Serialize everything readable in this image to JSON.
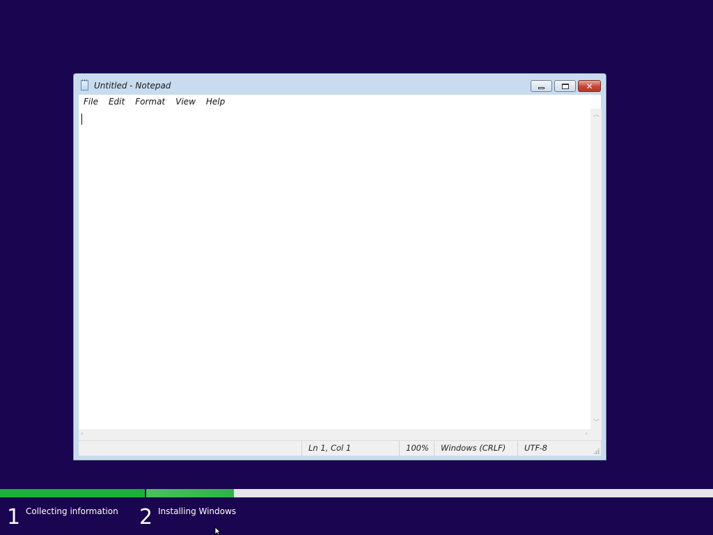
{
  "window": {
    "title": "Untitled - Notepad",
    "controls": {
      "minimize": "minimize",
      "maximize": "maximize",
      "close": "✕"
    }
  },
  "menu": {
    "items": [
      {
        "label": "File"
      },
      {
        "label": "Edit"
      },
      {
        "label": "Format"
      },
      {
        "label": "View"
      },
      {
        "label": "Help"
      }
    ]
  },
  "editor": {
    "content": ""
  },
  "statusbar": {
    "position": "Ln 1, Col 1",
    "zoom": "100%",
    "line_endings": "Windows (CRLF)",
    "encoding": "UTF-8"
  },
  "setup": {
    "steps": [
      {
        "number": "1",
        "label": "Collecting information",
        "progress": 1.0
      },
      {
        "number": "2",
        "label": "Installing Windows",
        "progress": 0.155
      }
    ],
    "colors": {
      "background": "#1a0550",
      "progress": "#1fae3c"
    }
  }
}
